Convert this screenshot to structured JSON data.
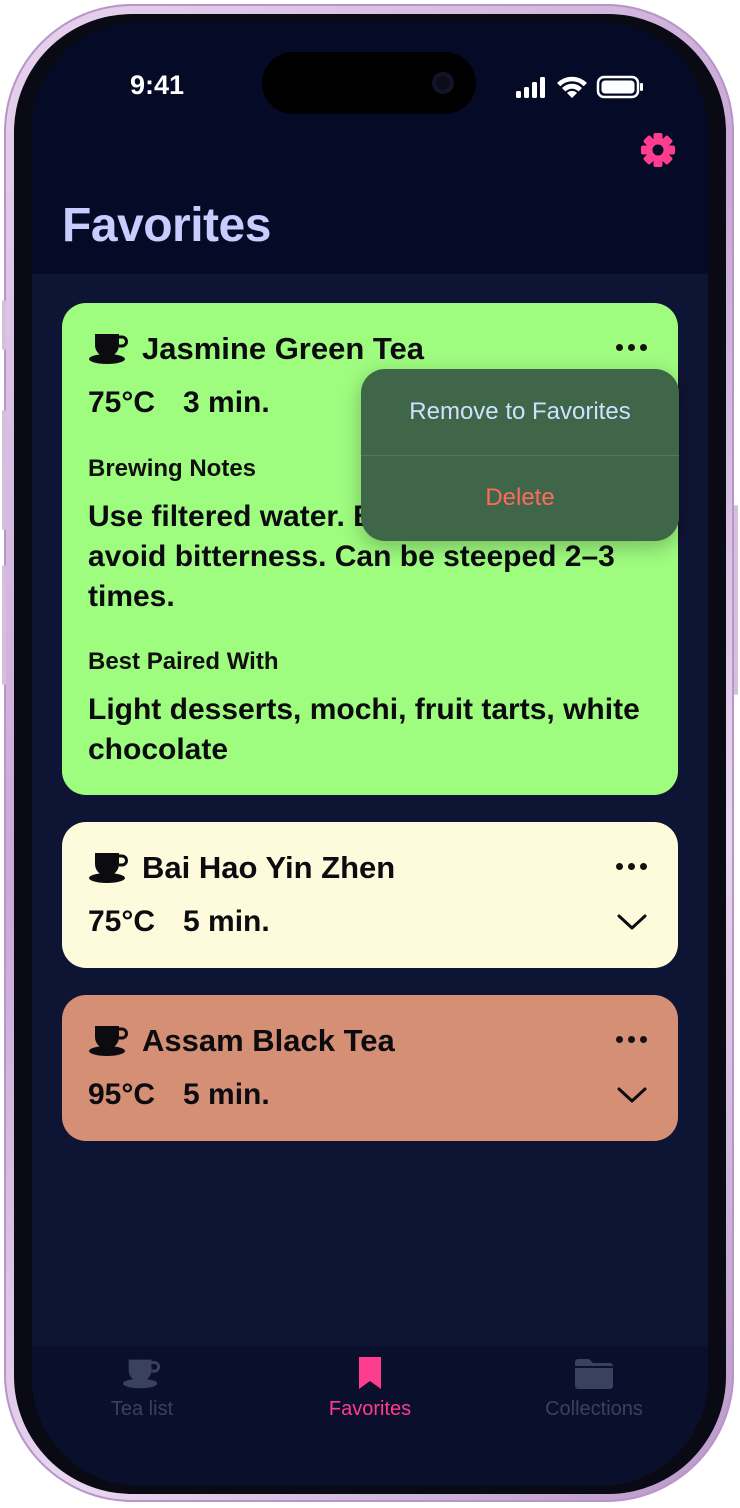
{
  "status_bar": {
    "time": "9:41"
  },
  "header": {
    "title": "Favorites",
    "settings_icon": "gear-icon"
  },
  "colors": {
    "accent": "#ff3d8f",
    "card_green": "#9efc7f",
    "card_cream": "#fdfbdc",
    "card_terracotta": "#d58f75",
    "menu_bg": "#3f6648",
    "delete": "#ff6a5c"
  },
  "teas": [
    {
      "name": "Jasmine Green Tea",
      "temperature": "75°C",
      "time": "3 min.",
      "expanded": true,
      "brewing_notes_label": "Brewing Notes",
      "brewing_notes": "Use filtered water. Brew at 75°C to avoid bitterness. Can be steeped 2–3 times.",
      "paired_label": "Best Paired With",
      "paired_with": "Light desserts, mochi, fruit tarts, white chocolate"
    },
    {
      "name": "Bai Hao Yin Zhen",
      "temperature": "75°C",
      "time": "5 min.",
      "expanded": false
    },
    {
      "name": "Assam Black Tea",
      "temperature": "95°C",
      "time": "5 min.",
      "expanded": false
    }
  ],
  "context_menu": {
    "items": [
      "Remove to Favorites",
      "Delete"
    ]
  },
  "tabs": [
    {
      "label": "Tea list",
      "icon": "teacup-icon",
      "active": false
    },
    {
      "label": "Favorites",
      "icon": "bookmark-icon",
      "active": true
    },
    {
      "label": "Collections",
      "icon": "folder-icon",
      "active": false
    }
  ]
}
